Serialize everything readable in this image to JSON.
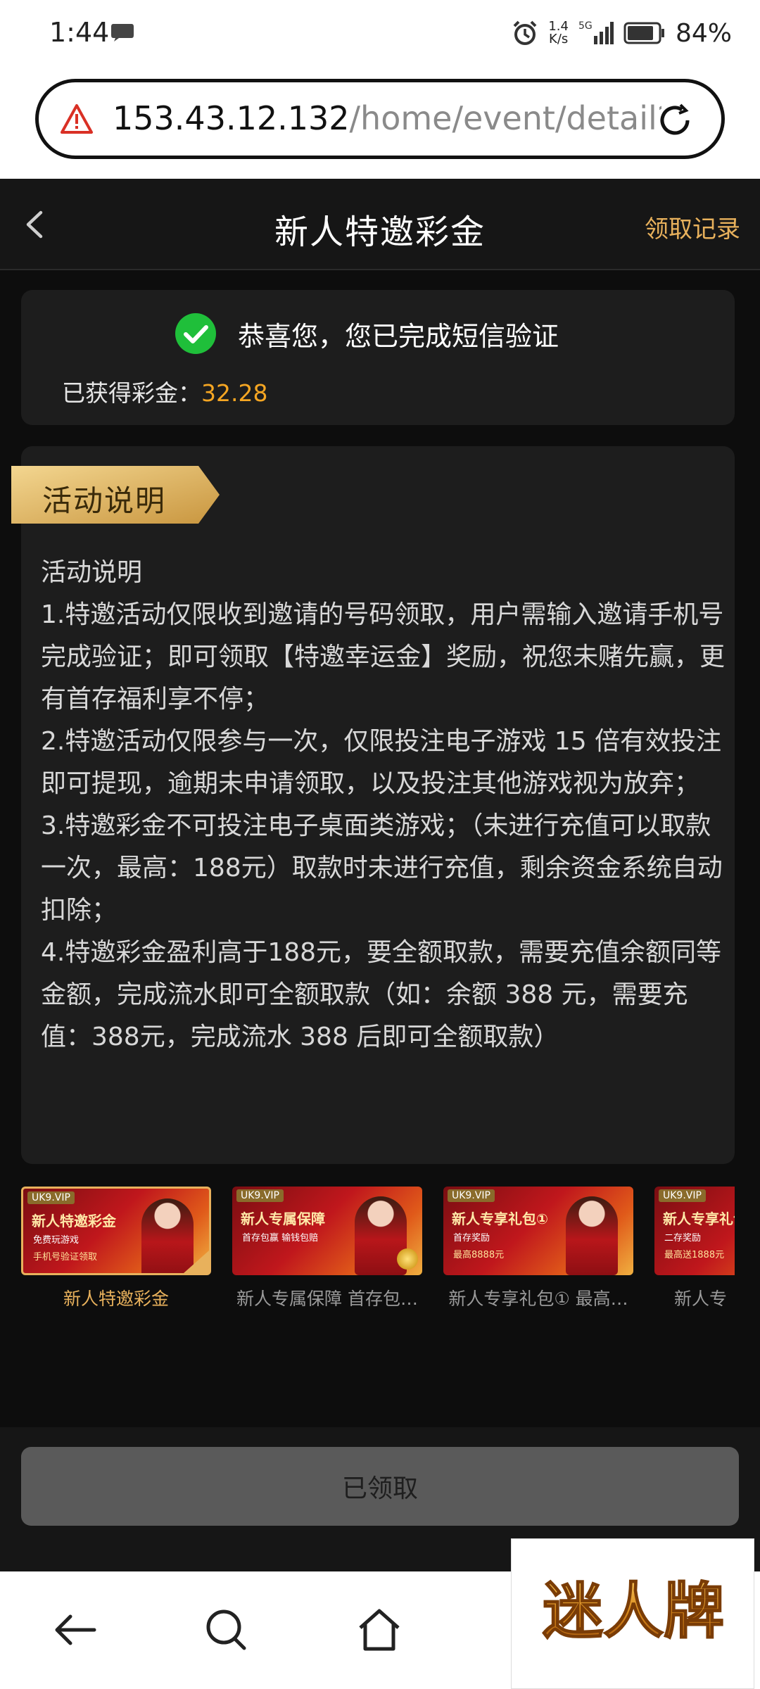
{
  "status_bar": {
    "time": "1:44",
    "net_speed_value": "1.4",
    "net_speed_unit": "K/s",
    "network": "5G",
    "battery": "84%"
  },
  "browser": {
    "url_host": "153.43.12.132",
    "url_path": "/home/event/detail?"
  },
  "header": {
    "title": "新人特邀彩金",
    "records_link": "领取记录"
  },
  "verify_card": {
    "message": "恭喜您，您已完成短信验证",
    "bonus_label": "已获得彩金：",
    "bonus_value": "32.28"
  },
  "rules": {
    "tag": "活动说明",
    "heading": "活动说明",
    "items": [
      "1.特邀活动仅限收到邀请的号码领取，用户需输入邀请手机号完成验证；即可领取【特邀幸运金】奖励，祝您未赌先赢，更有首存福利享不停；",
      "2.特邀活动仅限参与一次，仅限投注电子游戏 15 倍有效投注即可提现，逾期未申请领取，以及投注其他游戏视为放弃；",
      "3.特邀彩金不可投注电子桌面类游戏；（未进行充值可以取款一次，最高：188元）取款时未进行充值，剩余资金系统自动扣除；",
      "4.特邀彩金盈利高于188元，要全额取款，需要充值余额同等金额，完成流水即可全额取款（如：余额 388 元，需要充值：388元，完成流水 388 后即可全额取款）"
    ]
  },
  "promos": [
    {
      "label": "新人特邀彩金",
      "brand": "UK9.VIP",
      "headline": "新人特邀彩金",
      "sub": "免费玩游戏",
      "sub2": "手机号验证领取",
      "active": true
    },
    {
      "label": "新人专属保障 首存包…",
      "brand": "UK9.VIP",
      "headline": "新人专属保障",
      "sub": "首存包赢 输钱包赔",
      "sub2": "",
      "active": false
    },
    {
      "label": "新人专享礼包① 最高…",
      "brand": "UK9.VIP",
      "headline": "新人专享礼包①",
      "sub": "首存奖励",
      "sub2": "最高8888元",
      "active": false
    },
    {
      "label": "新人专",
      "brand": "UK9.VIP",
      "headline": "新人专享礼包",
      "sub": "二存奖励",
      "sub2": "最高送1888元",
      "active": false
    }
  ],
  "action": {
    "button_label": "已领取"
  },
  "watermark": {
    "text": "迷人牌"
  },
  "colors": {
    "accent_gold": "#e8b15c",
    "bonus_orange": "#f5a623",
    "success_green": "#1fbf3a",
    "warning_red": "#d93025"
  },
  "icons": {
    "back": "chevron-left-icon",
    "warning": "warning-triangle-icon",
    "reload": "reload-icon",
    "check": "check-circle-icon",
    "nav_back": "arrow-left-icon",
    "nav_search": "search-icon",
    "nav_home": "home-icon"
  }
}
